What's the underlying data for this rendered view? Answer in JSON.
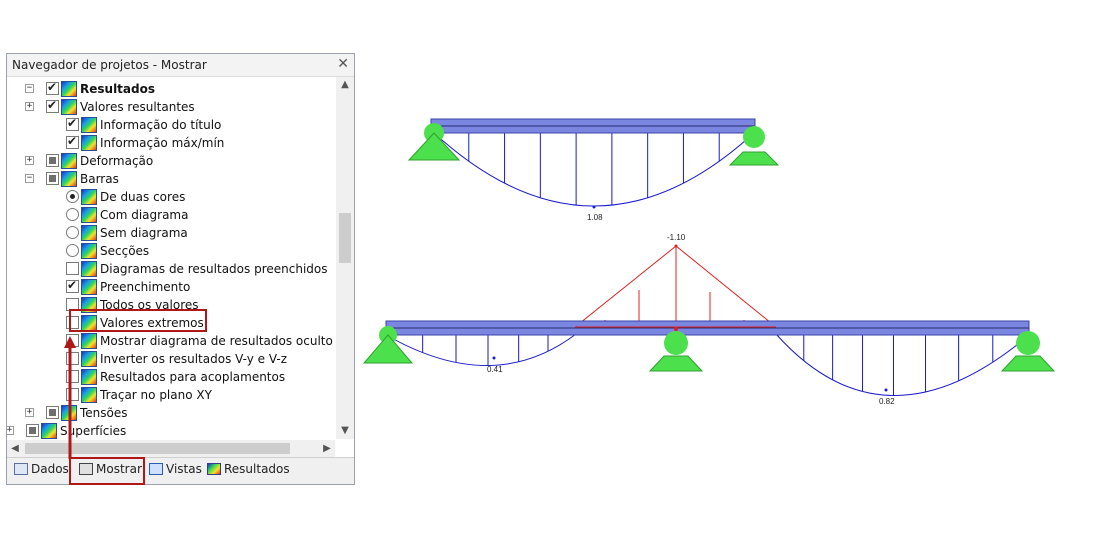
{
  "panel": {
    "title": "Navegador de projetos - Mostrar",
    "close_glyph": "✕"
  },
  "tree": [
    {
      "label": "Resultados",
      "state": "checked",
      "bold": true,
      "expander": "−"
    },
    {
      "label": "Valores resultantes",
      "state": "checked",
      "expander": "+"
    },
    {
      "label": "Informação do título",
      "state": "checked"
    },
    {
      "label": "Informação máx/mín",
      "state": "checked"
    },
    {
      "label": "Deformação",
      "state": "partial",
      "expander": "+"
    },
    {
      "label": "Barras",
      "state": "partial",
      "expander": "−"
    },
    {
      "label": "De duas cores",
      "state": "radio-checked"
    },
    {
      "label": "Com diagrama",
      "state": "radio"
    },
    {
      "label": "Sem diagrama",
      "state": "radio"
    },
    {
      "label": "Secções",
      "state": "radio"
    },
    {
      "label": "Diagramas de resultados preenchidos",
      "state": "unchecked"
    },
    {
      "label": "Preenchimento",
      "state": "checked"
    },
    {
      "label": "Todos os valores",
      "state": "unchecked"
    },
    {
      "label": "Valores extremos",
      "state": "unchecked",
      "highlighted": true
    },
    {
      "label": "Mostrar diagrama de resultados oculto",
      "state": "unchecked"
    },
    {
      "label": "Inverter os resultados V-y e V-z",
      "state": "unchecked"
    },
    {
      "label": "Resultados para acoplamentos",
      "state": "unchecked"
    },
    {
      "label": "Traçar no plano XY",
      "state": "unchecked"
    },
    {
      "label": "Tensões",
      "state": "partial",
      "expander": "+"
    },
    {
      "label": "Superfícies",
      "state": "partial",
      "expander": "+"
    }
  ],
  "tabs": [
    {
      "label": "Dados"
    },
    {
      "label": "Mostrar",
      "active": true
    },
    {
      "label": "Vistas"
    },
    {
      "label": "Resultados"
    }
  ],
  "diagram": {
    "top_beam_value": "1.08",
    "bottom_beam_values": [
      "-1.10",
      "0.41",
      "0.82"
    ],
    "colors": {
      "beam": "#7b86e0",
      "support": "#4ce04c",
      "positive": "#1a1acf",
      "negative": "#e02020",
      "highlight": "#b01818"
    }
  }
}
